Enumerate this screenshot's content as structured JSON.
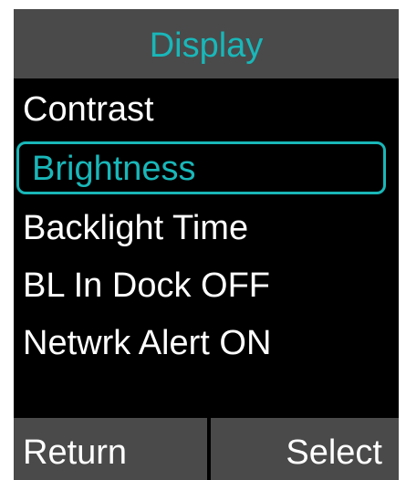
{
  "title": "Display",
  "menu": {
    "items": [
      {
        "label": "Contrast"
      },
      {
        "label": "Brightness"
      },
      {
        "label": "Backlight Time"
      },
      {
        "label": "BL In Dock OFF"
      },
      {
        "label": "Netwrk Alert ON"
      }
    ],
    "selected_label": "Brightness"
  },
  "softkeys": {
    "left_label": "Return",
    "right_label": "Select"
  },
  "colors": {
    "accent": "#19b7b9",
    "bar_background": "#4a4a4a",
    "screen_background": "#000000",
    "text": "#ffffff"
  }
}
